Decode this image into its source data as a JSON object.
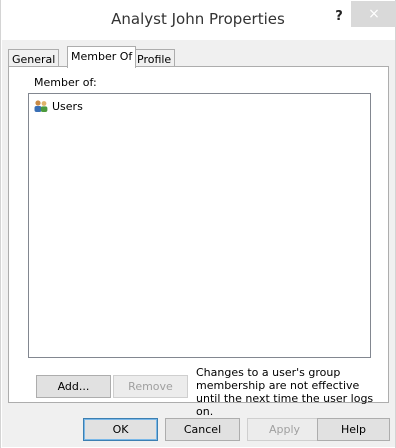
{
  "window": {
    "title": "Analyst John Properties",
    "help_label": "?",
    "close_label": "×"
  },
  "tabs": [
    {
      "label": "General"
    },
    {
      "label": "Member Of",
      "selected": true
    },
    {
      "label": "Profile"
    }
  ],
  "member_of": {
    "label": "Member of:",
    "items": [
      {
        "icon": "users-group-icon",
        "label": "Users"
      }
    ],
    "add_label": "Add...",
    "remove_label": "Remove",
    "note": "Changes to a user's group membership are not effective until the next time the user logs on."
  },
  "footer": {
    "ok_label": "OK",
    "cancel_label": "Cancel",
    "apply_label": "Apply",
    "help_label": "Help"
  }
}
